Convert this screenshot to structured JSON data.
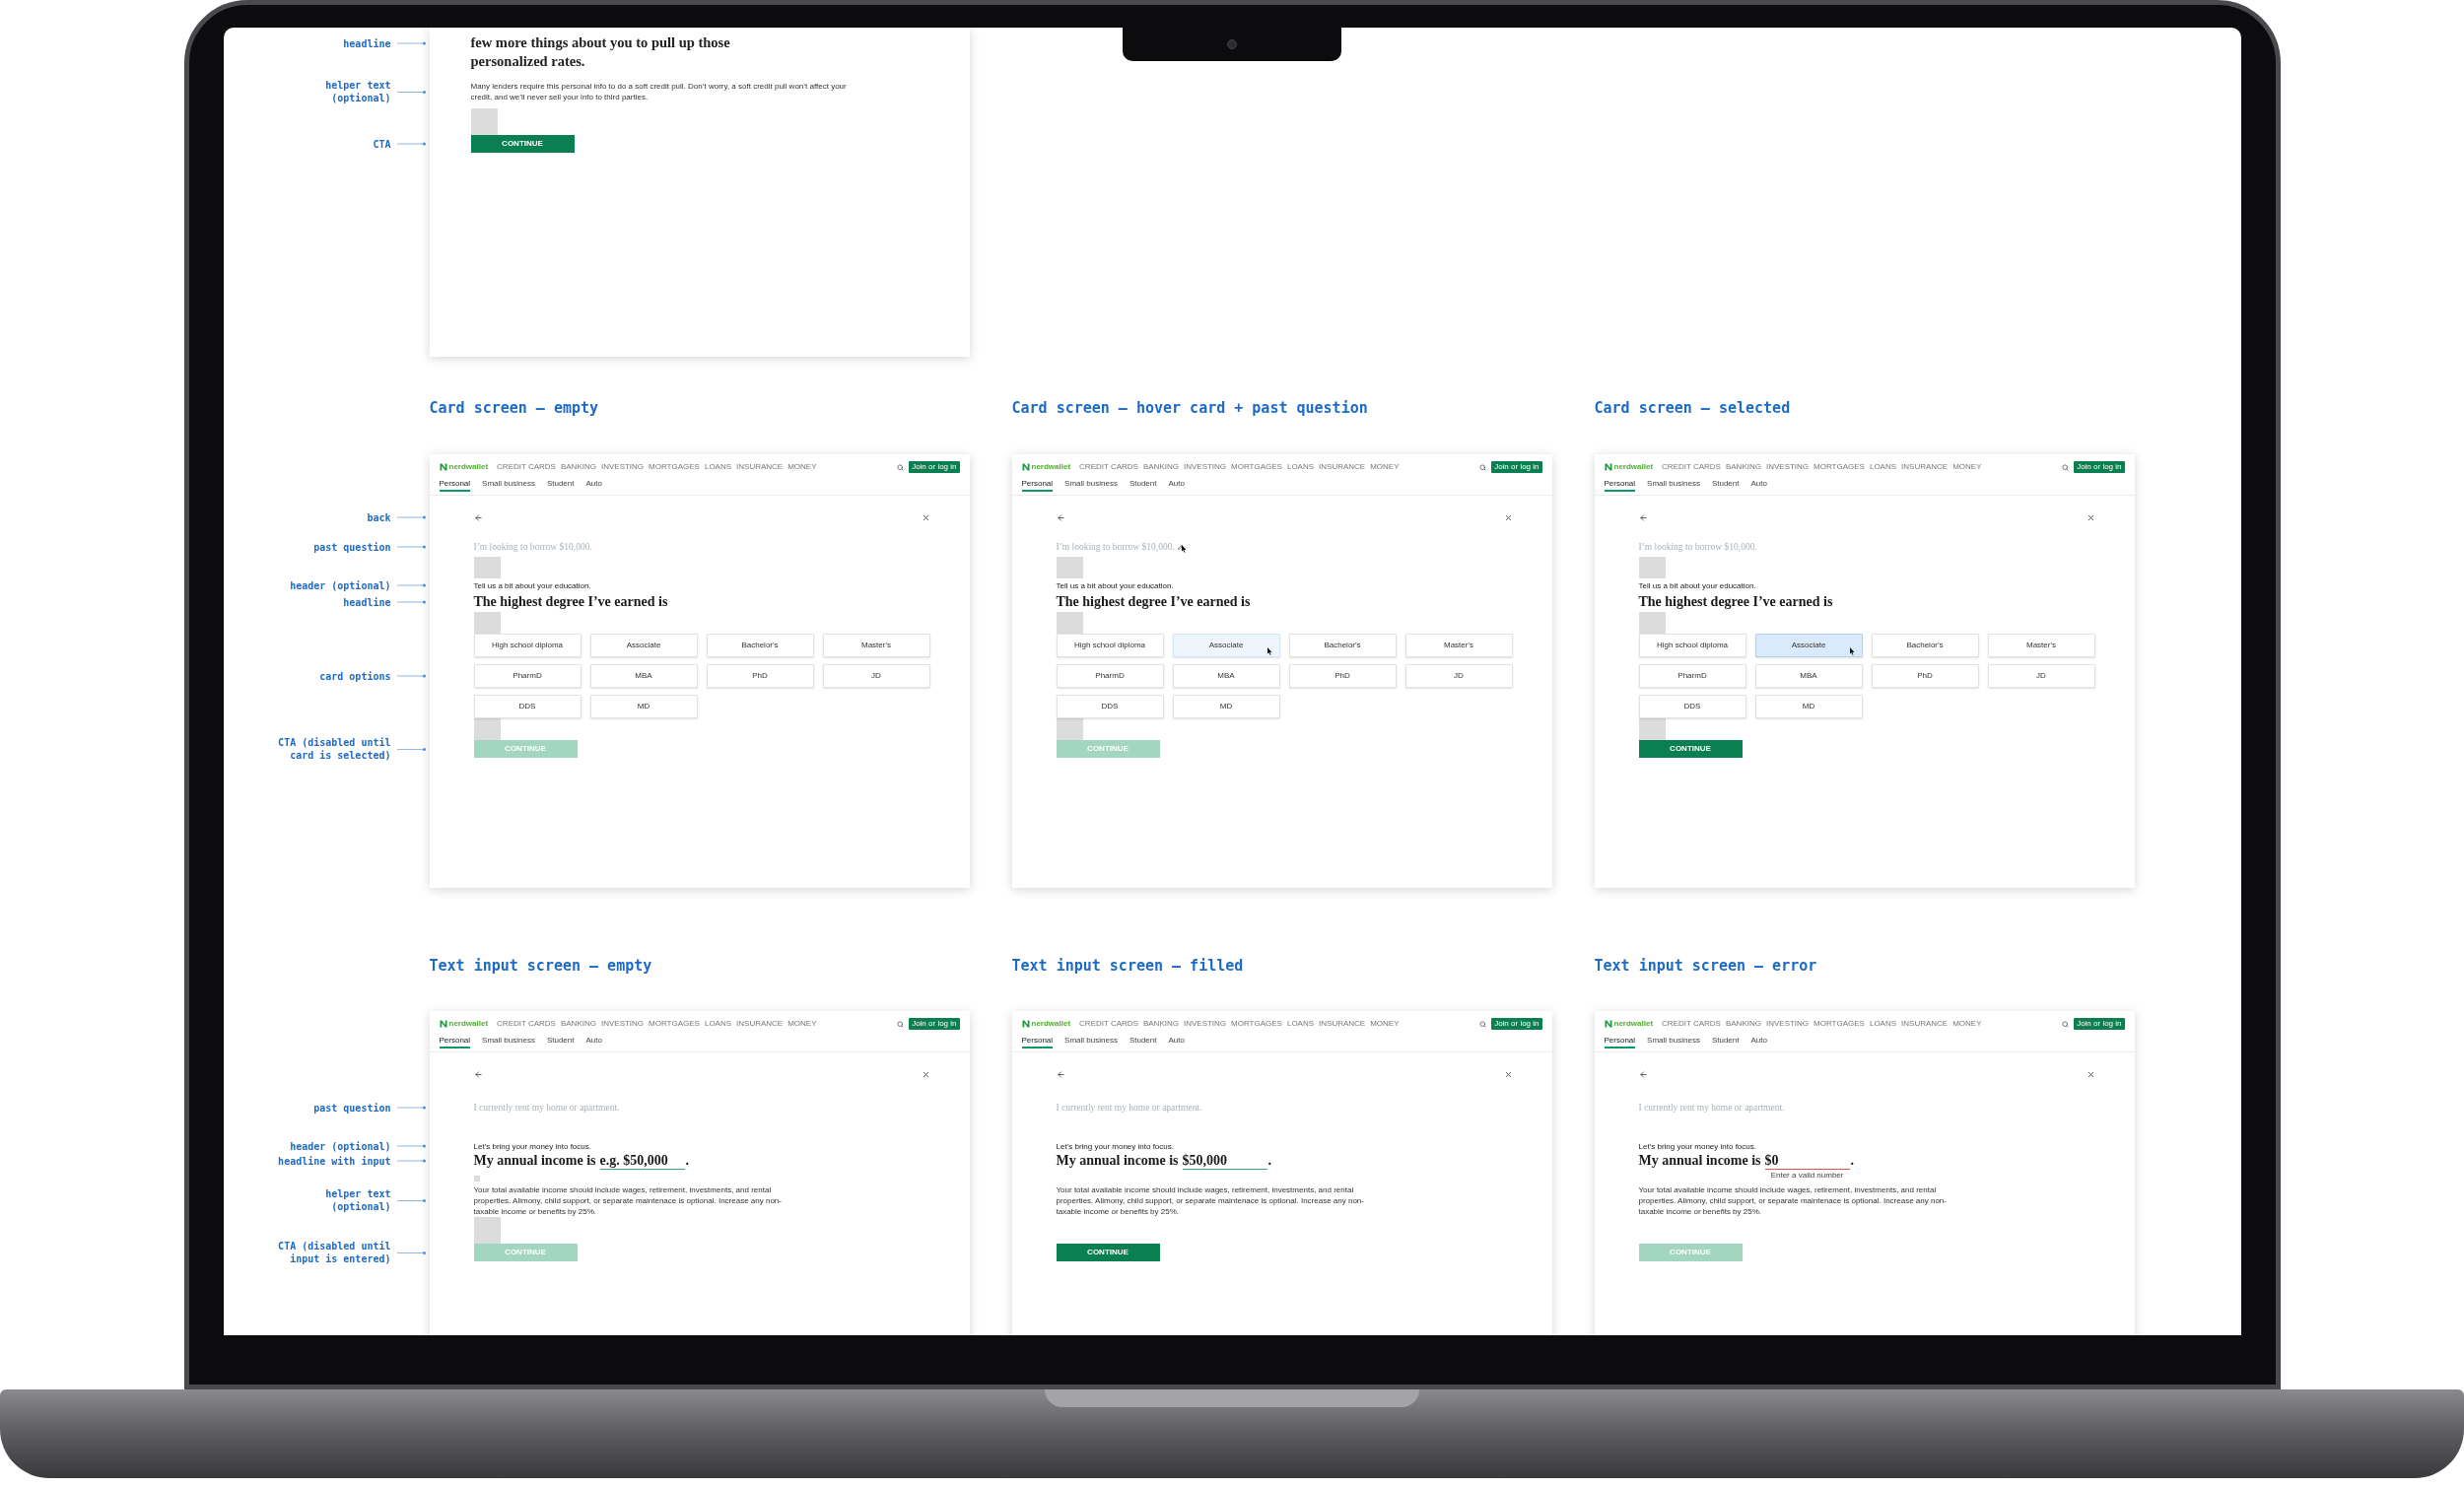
{
  "canvas": {
    "intro_frame": {
      "headline": "few more things about you to pull up those personalized rates.",
      "helper_text": "Many lenders require this personal info to do a soft credit pull. Don’t worry, a soft credit pull won’t affect your credit, and we’ll never sell your info to third parties.",
      "show_spacers": true,
      "cta": {
        "label": "CONTINUE",
        "disabled": false
      }
    },
    "intro_annotations": [
      {
        "label": "headline"
      },
      {
        "label": "helper text (optional)"
      },
      {
        "label": "CTA"
      }
    ],
    "card_annotations": [
      {
        "label": "back"
      },
      {
        "label": "past question"
      },
      {
        "label": "header (optional)"
      },
      {
        "label": "headline"
      },
      {
        "label": "card options"
      },
      {
        "label": "CTA (disabled until card is selected)"
      }
    ],
    "card_screens": [
      {
        "title": "Card screen – empty",
        "nav": {
          "logo": "nerdwallet",
          "links": [
            "CREDIT CARDS",
            "BANKING",
            "INVESTING",
            "MORTGAGES",
            "LOANS",
            "INSURANCE",
            "MONEY"
          ],
          "button": "Join or log in",
          "tabs": [
            {
              "label": "Personal",
              "selected": true
            },
            {
              "label": "Small business",
              "selected": false
            },
            {
              "label": "Student",
              "selected": false
            },
            {
              "label": "Auto",
              "selected": false
            }
          ]
        },
        "past_question": {
          "text": "I’m looking to borrow $10,000.",
          "hovered": false
        },
        "show_spacers": true,
        "header": "Tell us a bit about your education.",
        "headline": "The highest degree I’ve earned is",
        "cards": [
          {
            "label": "High school diploma",
            "hovered": false,
            "selected": false
          },
          {
            "label": "Associate",
            "hovered": false,
            "selected": false
          },
          {
            "label": "Bachelor's",
            "hovered": false,
            "selected": false
          },
          {
            "label": "Master's",
            "hovered": false,
            "selected": false
          },
          {
            "label": "PharmD",
            "hovered": false,
            "selected": false
          },
          {
            "label": "MBA",
            "hovered": false,
            "selected": false
          },
          {
            "label": "PhD",
            "hovered": false,
            "selected": false
          },
          {
            "label": "JD",
            "hovered": false,
            "selected": false
          },
          {
            "label": "DDS",
            "hovered": false,
            "selected": false
          },
          {
            "label": "MD",
            "hovered": false,
            "selected": false
          }
        ],
        "cta": {
          "label": "CONTINUE",
          "disabled": true
        }
      },
      {
        "title": "Card screen – hover card + past question",
        "nav": {
          "logo": "nerdwallet",
          "links": [
            "CREDIT CARDS",
            "BANKING",
            "INVESTING",
            "MORTGAGES",
            "LOANS",
            "INSURANCE",
            "MONEY"
          ],
          "button": "Join or log in",
          "tabs": [
            {
              "label": "Personal",
              "selected": true
            },
            {
              "label": "Small business",
              "selected": false
            },
            {
              "label": "Student",
              "selected": false
            },
            {
              "label": "Auto",
              "selected": false
            }
          ]
        },
        "past_question": {
          "text": "I’m looking to borrow $10,000.",
          "hovered": true
        },
        "show_spacers": true,
        "header": "Tell us a bit about your education.",
        "headline": "The highest degree I’ve earned is",
        "cards": [
          {
            "label": "High school diploma",
            "hovered": false,
            "selected": false
          },
          {
            "label": "Associate",
            "hovered": true,
            "selected": false
          },
          {
            "label": "Bachelor's",
            "hovered": false,
            "selected": false
          },
          {
            "label": "Master's",
            "hovered": false,
            "selected": false
          },
          {
            "label": "PharmD",
            "hovered": false,
            "selected": false
          },
          {
            "label": "MBA",
            "hovered": false,
            "selected": false
          },
          {
            "label": "PhD",
            "hovered": false,
            "selected": false
          },
          {
            "label": "JD",
            "hovered": false,
            "selected": false
          },
          {
            "label": "DDS",
            "hovered": false,
            "selected": false
          },
          {
            "label": "MD",
            "hovered": false,
            "selected": false
          }
        ],
        "cta": {
          "label": "CONTINUE",
          "disabled": true
        }
      },
      {
        "title": "Card screen – selected",
        "nav": {
          "logo": "nerdwallet",
          "links": [
            "CREDIT CARDS",
            "BANKING",
            "INVESTING",
            "MORTGAGES",
            "LOANS",
            "INSURANCE",
            "MONEY"
          ],
          "button": "Join or log in",
          "tabs": [
            {
              "label": "Personal",
              "selected": true
            },
            {
              "label": "Small business",
              "selected": false
            },
            {
              "label": "Student",
              "selected": false
            },
            {
              "label": "Auto",
              "selected": false
            }
          ]
        },
        "past_question": {
          "text": "I’m looking to borrow $10,000.",
          "hovered": false
        },
        "show_spacers": true,
        "header": "Tell us a bit about your education.",
        "headline": "The highest degree I’ve earned is",
        "cards": [
          {
            "label": "High school diploma",
            "hovered": false,
            "selected": false
          },
          {
            "label": "Associate",
            "hovered": true,
            "selected": true
          },
          {
            "label": "Bachelor's",
            "hovered": false,
            "selected": false
          },
          {
            "label": "Master's",
            "hovered": false,
            "selected": false
          },
          {
            "label": "PharmD",
            "hovered": false,
            "selected": false
          },
          {
            "label": "MBA",
            "hovered": false,
            "selected": false
          },
          {
            "label": "PhD",
            "hovered": false,
            "selected": false
          },
          {
            "label": "JD",
            "hovered": false,
            "selected": false
          },
          {
            "label": "DDS",
            "hovered": false,
            "selected": false
          },
          {
            "label": "MD",
            "hovered": false,
            "selected": false
          }
        ],
        "cta": {
          "label": "CONTINUE",
          "disabled": false
        }
      }
    ],
    "text_annotations": [
      {
        "label": "past question"
      },
      {
        "label": "header (optional)"
      },
      {
        "label": "headline with input"
      },
      {
        "label": "helper text (optional)"
      },
      {
        "label": "CTA (disabled until input is entered)"
      }
    ],
    "text_screens": [
      {
        "title": "Text input screen – empty",
        "nav": {
          "logo": "nerdwallet",
          "links": [
            "CREDIT CARDS",
            "BANKING",
            "INVESTING",
            "MORTGAGES",
            "LOANS",
            "INSURANCE",
            "MONEY"
          ],
          "button": "Join or log in",
          "tabs": [
            {
              "label": "Personal",
              "selected": true
            },
            {
              "label": "Small business",
              "selected": false
            },
            {
              "label": "Student",
              "selected": false
            },
            {
              "label": "Auto",
              "selected": false
            }
          ]
        },
        "past_question": {
          "text": "I currently rent my home or apartment."
        },
        "show_spacers": true,
        "header": "Let’s bring your money into focus.",
        "headline": "My annual income is",
        "input": {
          "placeholder": "e.g. $50,000",
          "invalid": false
        },
        "headline_end": ".",
        "helper_text": "Your total available income should include wages, retirement, investments, and rental properties. Alimony, child support, or separate maintenace is optional. Increase any non-taxable income or benefits by 25%.",
        "cta": {
          "label": "CONTINUE",
          "disabled": true
        }
      },
      {
        "title": "Text input screen – filled",
        "nav": {
          "logo": "nerdwallet",
          "links": [
            "CREDIT CARDS",
            "BANKING",
            "INVESTING",
            "MORTGAGES",
            "LOANS",
            "INSURANCE",
            "MONEY"
          ],
          "button": "Join or log in",
          "tabs": [
            {
              "label": "Personal",
              "selected": true
            },
            {
              "label": "Small business",
              "selected": false
            },
            {
              "label": "Student",
              "selected": false
            },
            {
              "label": "Auto",
              "selected": false
            }
          ]
        },
        "past_question": {
          "text": "I currently rent my home or apartment."
        },
        "show_spacers": false,
        "header": "Let’s bring your money into focus.",
        "headline": "My annual income is",
        "input": {
          "value": "$50,000",
          "invalid": false
        },
        "headline_end": ".",
        "helper_text": "Your total available income should include wages, retirement, investments, and rental properties. Alimony, child support, or separate maintenace is optional. Increase any non-taxable income or benefits by 25%.",
        "cta": {
          "label": "CONTINUE",
          "disabled": false
        }
      },
      {
        "title": "Text input screen – error",
        "nav": {
          "logo": "nerdwallet",
          "links": [
            "CREDIT CARDS",
            "BANKING",
            "INVESTING",
            "MORTGAGES",
            "LOANS",
            "INSURANCE",
            "MONEY"
          ],
          "button": "Join or log in",
          "tabs": [
            {
              "label": "Personal",
              "selected": true
            },
            {
              "label": "Small business",
              "selected": false
            },
            {
              "label": "Student",
              "selected": false
            },
            {
              "label": "Auto",
              "selected": false
            }
          ]
        },
        "past_question": {
          "text": "I currently rent my home or apartment."
        },
        "show_spacers": false,
        "header": "Let’s bring your money into focus.",
        "headline": "My annual income is",
        "input": {
          "value": "$0",
          "invalid": true,
          "error": "Enter a valid number"
        },
        "headline_end": ".",
        "helper_text": "Your total available income should include wages, retirement, investments, and rental properties. Alimony, child support, or separate maintenace is optional. Increase any non-taxable income or benefits by 25%.",
        "cta": {
          "label": "CONTINUE",
          "disabled": true
        }
      }
    ]
  }
}
